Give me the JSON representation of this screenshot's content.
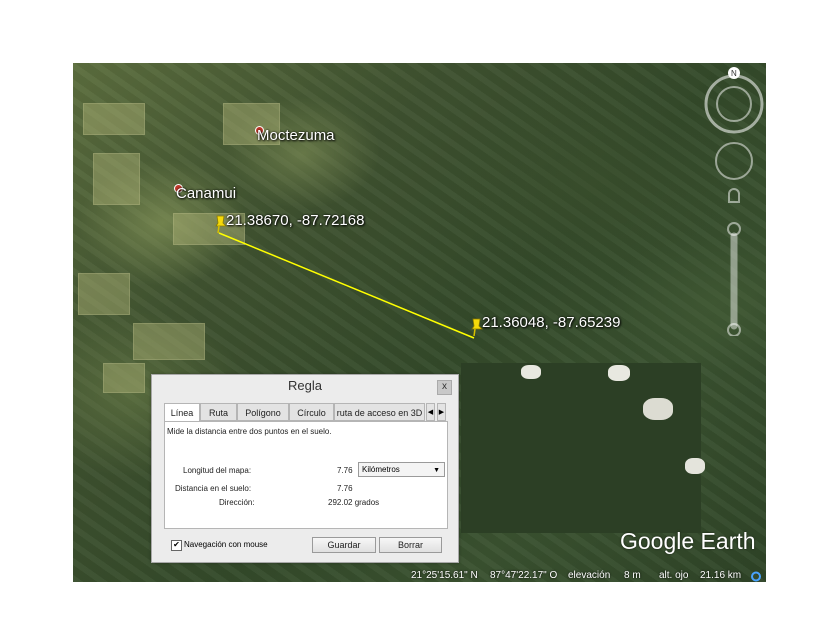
{
  "map": {
    "places": [
      {
        "name": "Moctezuma"
      },
      {
        "name": "Canamui"
      }
    ],
    "pins": [
      {
        "coords": "21.38670, -87.72168"
      },
      {
        "coords": "21.36048, -87.65239"
      }
    ],
    "logo": "Google Earth",
    "compass_label": "N",
    "status": {
      "lat": "21°25'15.61\" N",
      "lon": "87°47'22.17\" O",
      "elev_label": "elevación",
      "elev_value": "8 m",
      "alt_label": "alt. ojo",
      "alt_value": "21.16 km"
    }
  },
  "dialog": {
    "title": "Regla",
    "close_label": "x",
    "tabs": [
      {
        "label": "Línea"
      },
      {
        "label": "Ruta"
      },
      {
        "label": "Polígono"
      },
      {
        "label": "Círculo"
      },
      {
        "label": "ruta de acceso en 3D"
      }
    ],
    "description": "Mide la distancia entre dos puntos en el suelo.",
    "map_length_label": "Longitud del mapa:",
    "map_length_value": "7.76",
    "unit_selected": "Kilómetros",
    "ground_distance_label": "Distancia en el suelo:",
    "ground_distance_value": "7.76",
    "direction_label": "Dirección:",
    "direction_value": "292.02 grados",
    "mouse_nav_label": "Navegación con mouse",
    "mouse_nav_checked": true,
    "save_label": "Guardar",
    "clear_label": "Borrar"
  }
}
